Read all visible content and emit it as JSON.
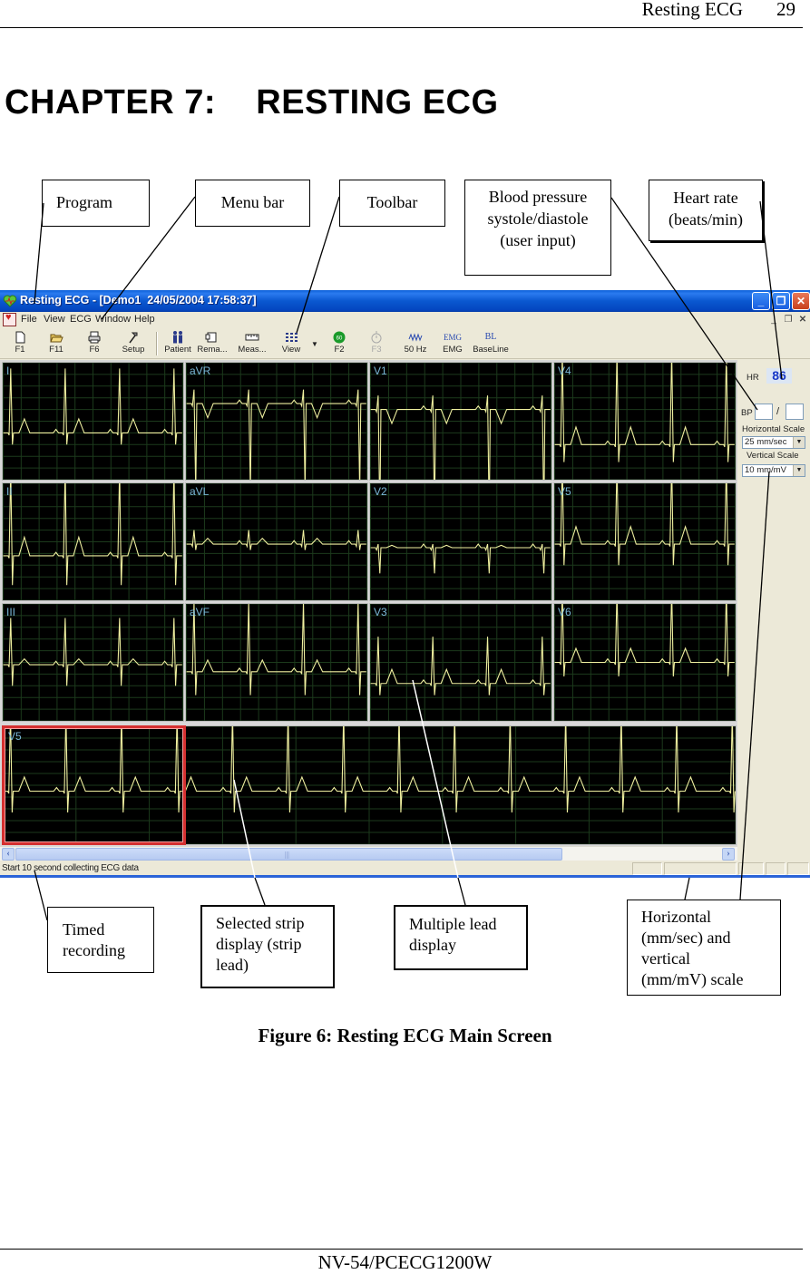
{
  "page": {
    "running_title": "Resting ECG",
    "page_number": "29",
    "chapter_title": "CHAPTER 7:    RESTING ECG",
    "figure_caption": "Figure 6: Resting ECG Main Screen",
    "footer": "NV-54/PCECG1200W"
  },
  "callouts": {
    "program": "Program",
    "menu_bar": "Menu bar",
    "toolbar": "Toolbar",
    "blood_pressure": [
      "Blood pressure",
      "systole/diastole",
      "(user input)"
    ],
    "heart_rate": [
      "Heart rate",
      "(beats/min)"
    ],
    "timed_recording": [
      "Timed",
      "recording"
    ],
    "selected_strip": [
      "Selected strip",
      "display (strip",
      "lead)"
    ],
    "multiple_lead": [
      "Multiple lead",
      "display"
    ],
    "scale": [
      "Horizontal",
      "(mm/sec) and",
      "vertical",
      "(mm/mV) scale"
    ]
  },
  "window": {
    "title": "Resting ECG - [Demo1  24/05/2004 17:58:37]",
    "controls": {
      "minimize": "_",
      "restore": "❐",
      "close": "✕"
    },
    "menu": [
      {
        "label": "File",
        "accel": "F"
      },
      {
        "label": "View",
        "accel": "V"
      },
      {
        "label": "ECG",
        "accel": "E"
      },
      {
        "label": "Window",
        "accel": "W"
      },
      {
        "label": "Help",
        "accel": "H"
      }
    ],
    "mdi_controls": {
      "minimize": "_",
      "restore": "❐",
      "close": "✕"
    },
    "toolbar": [
      {
        "label": "F1",
        "icon": "new-file-icon",
        "glyph": "🗋",
        "enabled": true
      },
      {
        "label": "F11",
        "icon": "open-folder-icon",
        "glyph": "📂",
        "enabled": true
      },
      {
        "label": "F6",
        "icon": "printer-icon",
        "glyph": "⎙",
        "enabled": true
      },
      {
        "label": "Setup",
        "icon": "hammer-icon",
        "glyph": "⚒",
        "enabled": true
      },
      {
        "label": "Patient",
        "icon": "patient-icon",
        "glyph": "♟♟",
        "enabled": true
      },
      {
        "label": "Rema...",
        "icon": "remark-icon",
        "glyph": "❐",
        "enabled": true
      },
      {
        "label": "Meas...",
        "icon": "ruler-icon",
        "glyph": "┅",
        "enabled": true
      },
      {
        "label": "View",
        "icon": "grid-view-icon",
        "glyph": "∷",
        "enabled": true
      },
      {
        "label": "F2",
        "icon": "go-icon",
        "glyph": "●",
        "enabled": true
      },
      {
        "label": "F3",
        "icon": "timer-icon",
        "glyph": "⏱",
        "enabled": false
      },
      {
        "label": "50 Hz",
        "icon": "filter-50hz-icon",
        "glyph": "∿∿",
        "enabled": true
      },
      {
        "label": "EMG",
        "icon": "emg-filter-icon",
        "glyph": "EMG",
        "enabled": true
      },
      {
        "label": "BaseLine",
        "icon": "baseline-icon",
        "glyph": "BL",
        "enabled": true
      }
    ],
    "leads": {
      "grid": [
        [
          "I",
          "aVR",
          "V1",
          "V4"
        ],
        [
          "II",
          "aVL",
          "V2",
          "V5"
        ],
        [
          "III",
          "aVF",
          "V3",
          "V6"
        ]
      ],
      "strip_lead": "V5",
      "strip_label_visible": "V5"
    },
    "controls_panel": {
      "hr_label": "HR",
      "hr_value": "86",
      "bp_label": "BP",
      "bp_systole": "",
      "bp_diastole": "",
      "bp_separator": "/",
      "horizontal_scale_label": "Horizontal Scale",
      "horizontal_scale_value": "25 mm/sec",
      "vertical_scale_label": "Vertical Scale",
      "vertical_scale_value": "10 mm/mV"
    },
    "status": "Start 10 second collecting ECG data",
    "colors": {
      "trace": "#f0f0a0",
      "grid": "#1c3a1c",
      "label": "#7ab8d8",
      "selection": "#d43030",
      "hr_value": "#1838c8"
    }
  }
}
